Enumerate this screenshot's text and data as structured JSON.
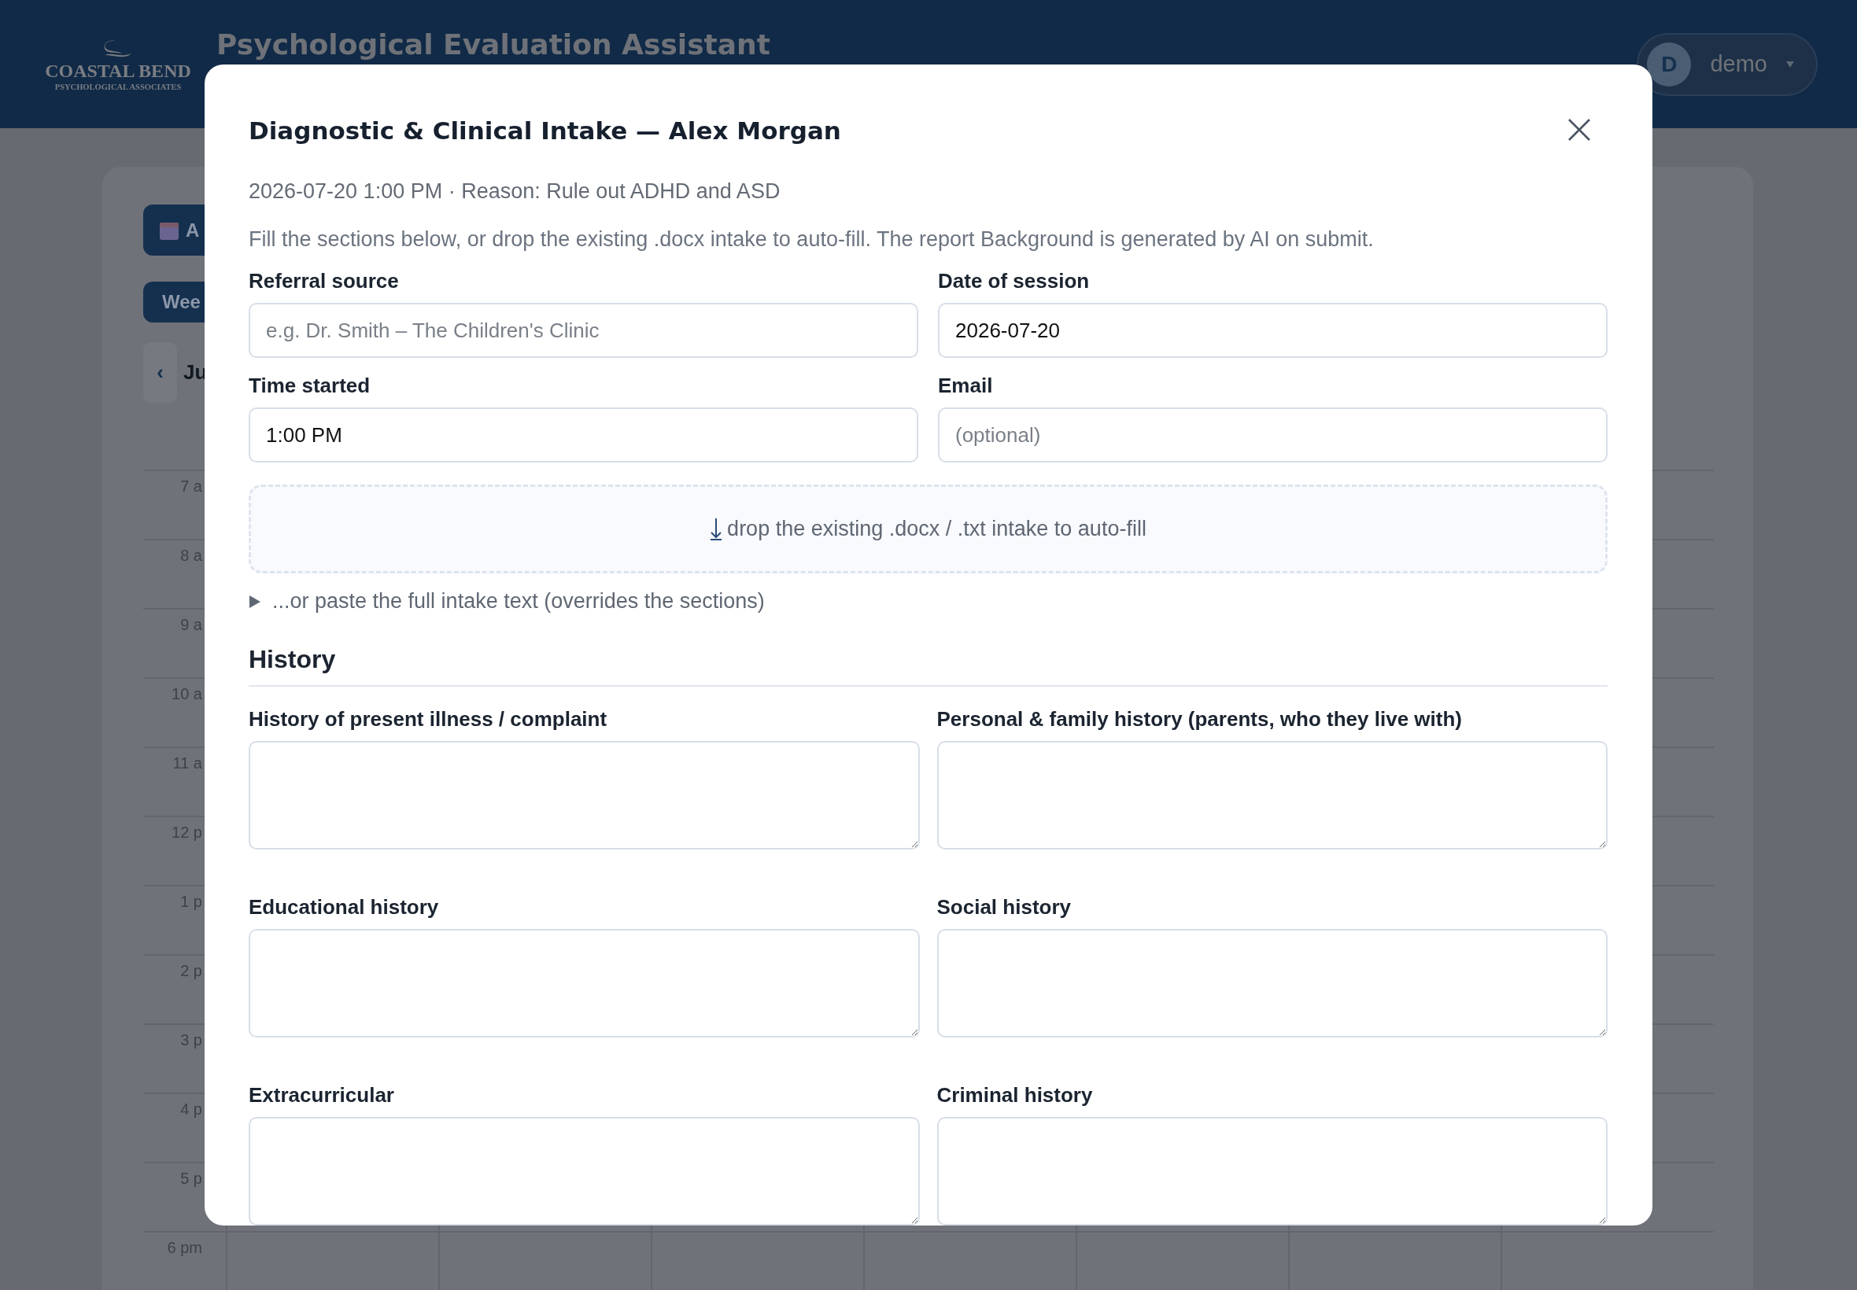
{
  "header": {
    "logo": {
      "name": "COASTAL BEND",
      "tagline": "PSYCHOLOGICAL ASSOCIATES"
    },
    "title": "Psychological Evaluation Assistant",
    "user": {
      "initial": "D",
      "name": "demo"
    }
  },
  "calendar": {
    "toolbar_button": "A",
    "view_tab": "Wee",
    "prev": "‹",
    "month": "Ju",
    "hours": [
      "7 a",
      "8 a",
      "9 a",
      "10 a",
      "11 a",
      "12 p",
      "1 p",
      "2 p",
      "3 p",
      "4 p",
      "5 p",
      "6 pm"
    ]
  },
  "modal": {
    "title": "Diagnostic & Clinical Intake — Alex Morgan",
    "meta": "2026-07-20 1:00 PM · Reason: Rule out ADHD and ASD",
    "instructions": "Fill the sections below, or drop the existing .docx intake to auto-fill. The report Background is generated by AI on submit.",
    "fields": [
      {
        "label": "Referral source",
        "placeholder": "e.g. Dr. Smith – The Children's Clinic"
      },
      {
        "label": "Date of session",
        "value": "2026-07-20"
      },
      {
        "label": "Time started",
        "value": "1:00 PM"
      },
      {
        "label": "Email",
        "placeholder": "(optional)"
      }
    ],
    "dropzone": {
      "text": "drop the existing .docx / .txt intake to auto-fill"
    },
    "paste_toggle": {
      "text": "...or paste the full intake text (overrides the sections)",
      "expanded": false
    },
    "sections": [
      {
        "heading": "History",
        "fields": [
          {
            "label": "History of present illness / complaint"
          },
          {
            "label": "Personal & family history (parents, who they live with)"
          },
          {
            "label": "Educational history"
          },
          {
            "label": "Social history"
          },
          {
            "label": "Extracurricular"
          },
          {
            "label": "Criminal history"
          }
        ]
      }
    ]
  }
}
